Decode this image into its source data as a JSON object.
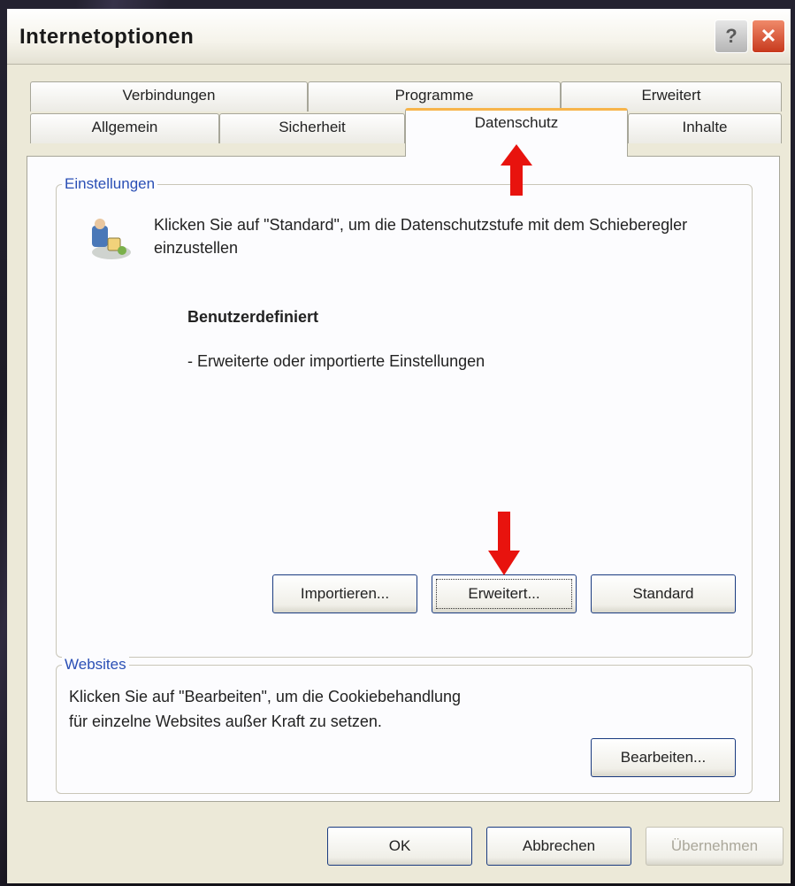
{
  "dialog": {
    "title": "Internetoptionen",
    "help_label": "?",
    "close_label": "✕"
  },
  "tabs": {
    "row1": [
      "Verbindungen",
      "Programme",
      "Erweitert"
    ],
    "row2": [
      "Allgemein",
      "Sicherheit",
      "Datenschutz",
      "Inhalte"
    ],
    "active": "Datenschutz"
  },
  "settings": {
    "group_label": "Einstellungen",
    "description": "Klicken Sie auf \"Standard\", um die Datenschutzstufe mit dem Schieberegler einzustellen",
    "level_title": "Benutzerdefiniert",
    "level_desc": "- Erweiterte oder importierte Einstellungen",
    "import_label": "Importieren...",
    "advanced_label": "Erweitert...",
    "default_label": "Standard"
  },
  "websites": {
    "group_label": "Websites",
    "description_line1": "Klicken Sie auf \"Bearbeiten\", um die Cookiebehandlung",
    "description_line2": "für einzelne Websites außer Kraft zu setzen.",
    "edit_label": "Bearbeiten..."
  },
  "footer": {
    "ok_label": "OK",
    "cancel_label": "Abbrechen",
    "apply_label": "Übernehmen"
  },
  "colors": {
    "arrow": "#e8130e",
    "group_label": "#2a4fb5",
    "active_tab_accent": "#f7b44a"
  },
  "icons": {
    "privacy": "privacy-person-icon",
    "arrow": "red-arrow-icon"
  }
}
